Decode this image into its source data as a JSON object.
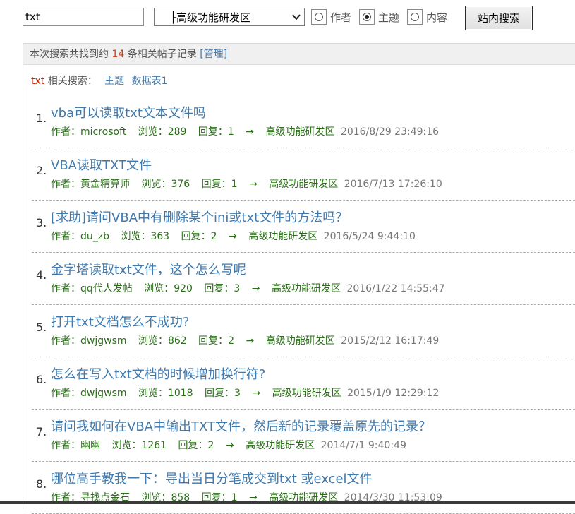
{
  "search": {
    "keyword": "txt",
    "forum_selected": "├高级功能研发区",
    "options": [
      {
        "label": "作者",
        "selected": false
      },
      {
        "label": "主题",
        "selected": true
      },
      {
        "label": "内容",
        "selected": false
      }
    ],
    "button_label": "站内搜索"
  },
  "summary": {
    "prefix": "本次搜索共找到约",
    "count": "14",
    "suffix": "条相关帖子记录",
    "manage": "[管理]"
  },
  "related": {
    "keyword": "txt",
    "label": "相关搜索：",
    "links": [
      "主题",
      "数据表1"
    ]
  },
  "results": [
    {
      "num": "1.",
      "title": "vba可以读取txt文本文件吗",
      "author": "作者：microsoft",
      "views": "浏览：289",
      "replies": "回复：1",
      "arrow": "→",
      "forum": "高级功能研发区",
      "date": "2016/8/29 23:49:16"
    },
    {
      "num": "2.",
      "title": "VBA读取TXT文件",
      "author": "作者：黄金精算师",
      "views": "浏览：376",
      "replies": "回复：1",
      "arrow": "→",
      "forum": "高级功能研发区",
      "date": "2016/7/13 17:26:10"
    },
    {
      "num": "3.",
      "title": "[求助]请问VBA中有删除某个ini或txt文件的方法吗？",
      "author": "作者：du_zb",
      "views": "浏览：363",
      "replies": "回复：2",
      "arrow": "→",
      "forum": "高级功能研发区",
      "date": "2016/5/24 9:44:10"
    },
    {
      "num": "4.",
      "title": "金字塔读取txt文件，这个怎么写呢",
      "author": "作者：qq代人发帖",
      "views": "浏览：920",
      "replies": "回复：3",
      "arrow": "→",
      "forum": "高级功能研发区",
      "date": "2016/1/22 14:55:47"
    },
    {
      "num": "5.",
      "title": "打开txt文档怎么不成功?",
      "author": "作者：dwjgwsm",
      "views": "浏览：862",
      "replies": "回复：2",
      "arrow": "→",
      "forum": "高级功能研发区",
      "date": "2015/2/12 16:17:49"
    },
    {
      "num": "6.",
      "title": "怎么在写入txt文档的时候增加换行符?",
      "author": "作者：dwjgwsm",
      "views": "浏览：1018",
      "replies": "回复：3",
      "arrow": "→",
      "forum": "高级功能研发区",
      "date": "2015/1/9 12:29:12"
    },
    {
      "num": "7.",
      "title": "请问我如何在VBA中输出TXT文件，然后新的记录覆盖原先的记录？",
      "author": "作者：幽幽",
      "views": "浏览：1261",
      "replies": "回复：2",
      "arrow": "→",
      "forum": "高级功能研发区",
      "date": "2014/7/1 9:40:49"
    },
    {
      "num": "8.",
      "title": "哪位高手教我一下：导出当日分笔成交到txt 或excel文件",
      "author": "作者：寻找点金石",
      "views": "浏览：858",
      "replies": "回复：1",
      "arrow": "→",
      "forum": "高级功能研发区",
      "date": "2014/3/30 11:53:09"
    }
  ]
}
